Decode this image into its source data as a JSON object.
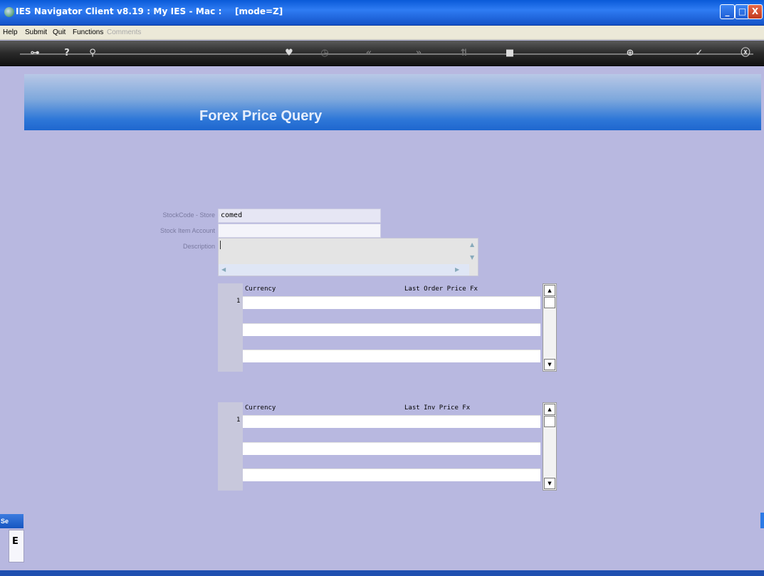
{
  "window": {
    "title": "IES Navigator Client v8.19 : My IES - Mac :",
    "mode": "[mode=Z]",
    "min_label": "_",
    "max_label": "□",
    "close_label": "X"
  },
  "menu": {
    "items": [
      "Help",
      "Submit",
      "Quit",
      "Functions",
      "Comments"
    ]
  },
  "toolbar": {
    "icons": [
      "key-icon",
      "help-icon",
      "search-icon",
      "heart-icon",
      "clock-icon",
      "rewind-icon",
      "fast-forward-icon",
      "swap-icon",
      "stop-icon",
      "add-icon",
      "check-icon",
      "close-icon"
    ]
  },
  "header": {
    "title": "Forex Price Query"
  },
  "form": {
    "stock_code_label": "StockCode - Store",
    "stock_code_value": "comed",
    "stock_item_account_label": "Stock Item Account",
    "stock_item_account_value": "",
    "description_label": "Description",
    "description_value": ""
  },
  "grid_orders": {
    "columns": [
      "Currency",
      "Last Order Price Fx"
    ],
    "rows": [
      {
        "num": "1",
        "currency": "",
        "price": ""
      },
      {
        "num": "",
        "currency": "",
        "price": ""
      },
      {
        "num": "",
        "currency": "",
        "price": ""
      }
    ]
  },
  "grid_invoices": {
    "columns": [
      "Currency",
      "Last Inv Price Fx"
    ],
    "rows": [
      {
        "num": "1",
        "currency": "",
        "price": ""
      },
      {
        "num": "",
        "currency": "",
        "price": ""
      },
      {
        "num": "",
        "currency": "",
        "price": ""
      }
    ]
  },
  "side": {
    "tab_label": "Se",
    "box_label": "E"
  },
  "colors": {
    "background": "#b8b8e0",
    "banner_blue": "#1e66cf",
    "titlebar_blue": "#0a5ad8"
  }
}
